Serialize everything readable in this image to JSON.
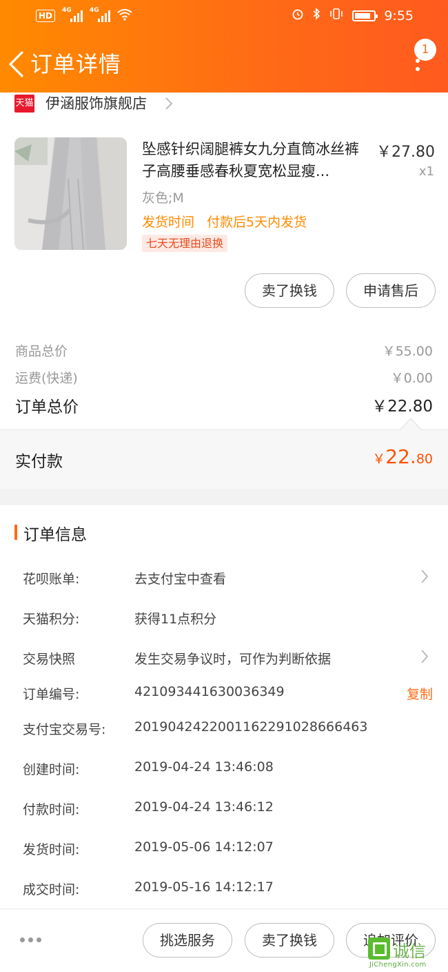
{
  "status_bar": {
    "hd": "HD",
    "sim1": "4G",
    "sim2": "4G",
    "time": "9:55"
  },
  "header": {
    "title": "订单详情",
    "badge": "1"
  },
  "shop": {
    "tag": "天猫",
    "name": "伊涵服饰旗舰店"
  },
  "product": {
    "title": "坠感针织阔腿裤女九分直筒冰丝裤子高腰垂感春秋夏宽松显瘦...",
    "price": "￥27.80",
    "qty": "x1",
    "spec": "灰色;M",
    "ship_label": "发货时间",
    "ship_value": "付款后5天内发货",
    "return_tag": "七天无理由退换"
  },
  "actions": {
    "sell": "卖了换钱",
    "after_sale": "申请售后"
  },
  "summary": {
    "goods_label": "商品总价",
    "goods_value": "￥55.00",
    "shipping_label": "运费(快递)",
    "shipping_value": "￥0.00",
    "total_label": "订单总价",
    "total_value": "￥22.80",
    "paid_label": "实付款",
    "paid_currency": "￥",
    "paid_int": "22.",
    "paid_dec": "80"
  },
  "order_info": {
    "title": "订单信息",
    "rows": [
      {
        "label": "花呗账单:",
        "value": "去支付宝中查看"
      },
      {
        "label": "天猫积分:",
        "value": "获得11点积分"
      },
      {
        "label": "交易快照",
        "value": "发生交易争议时，可作为判断依据"
      },
      {
        "label": "订单编号:",
        "value": "421093441630036349"
      },
      {
        "label": "支付宝交易号:",
        "value": "2019042422001162291028666463"
      },
      {
        "label": "创建时间:",
        "value": "2019-04-24 13:46:08"
      },
      {
        "label": "付款时间:",
        "value": "2019-04-24 13:46:12"
      },
      {
        "label": "发货时间:",
        "value": "2019-05-06 14:12:07"
      },
      {
        "label": "成交时间:",
        "value": "2019-05-16 14:12:17"
      }
    ],
    "copy": "复制"
  },
  "bottom": {
    "service": "挑选服务",
    "sell": "卖了换钱",
    "review": "追加评价"
  },
  "watermark": {
    "cn": "诚信",
    "en": "JiChengXin.com"
  },
  "colors": {
    "brand": "#ff6a16",
    "price_accent": "#ff5000",
    "tmall_red": "#e8192c"
  }
}
